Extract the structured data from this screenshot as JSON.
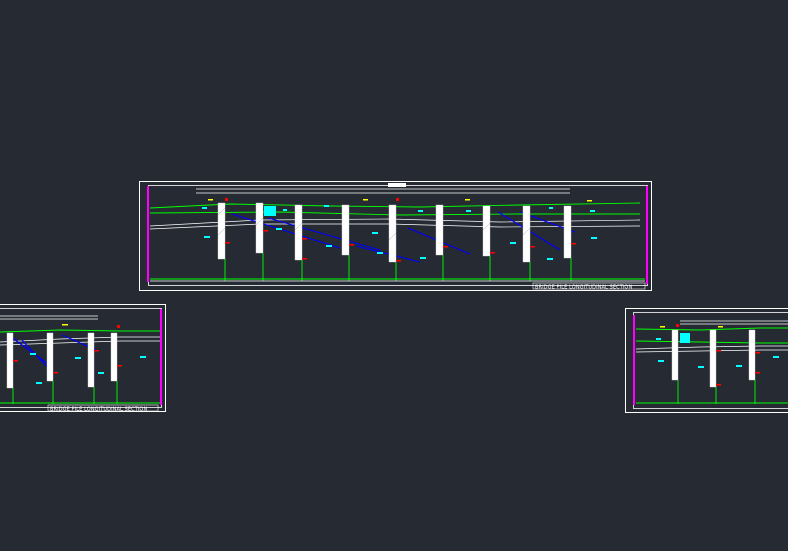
{
  "colors": {
    "background": "#252a33",
    "frame": "#ffffff",
    "ground_line": "#00ff00",
    "pile": "#ffffff",
    "layer_line_blue": "#0000ff",
    "label_cyan": "#00ffff",
    "tag_red": "#ff0000",
    "tag_yellow": "#ffff00",
    "border_magenta": "#ff00ff"
  },
  "drawings": [
    {
      "id": "main",
      "title_block": "BRIDGE PILE LONGITUDINAL SECTION",
      "piles": 9
    },
    {
      "id": "left",
      "title_block": "BRIDGE PILE LONGITUDINAL SECTION",
      "piles": 4
    },
    {
      "id": "right",
      "title_block": "",
      "piles": 3
    }
  ]
}
